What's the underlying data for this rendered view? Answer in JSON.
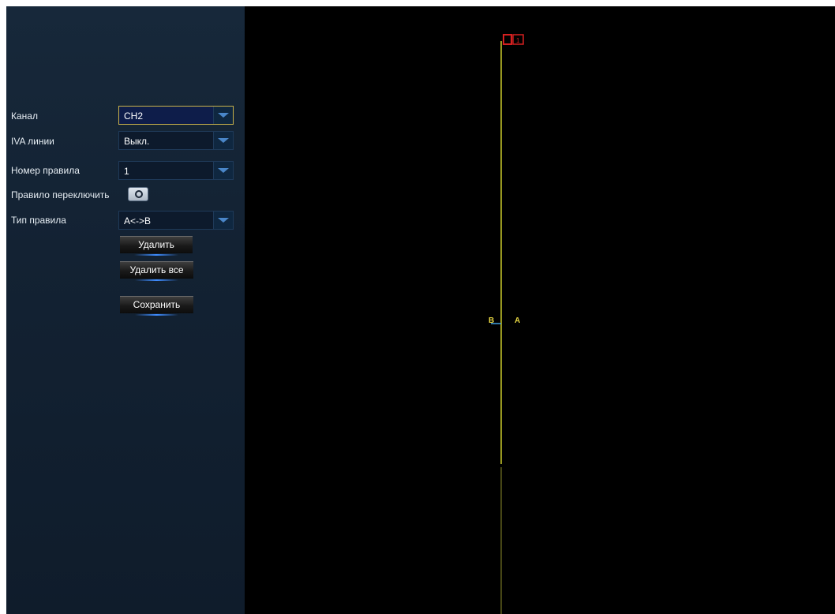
{
  "panel": {
    "channel": {
      "label": "Канал",
      "value": "CH2"
    },
    "iva_lines": {
      "label": "IVA линии",
      "value": "Выкл."
    },
    "rule_number": {
      "label": "Номер правила",
      "value": "1"
    },
    "rule_switch": {
      "label": "Правило переключить",
      "enabled": false
    },
    "rule_type": {
      "label": "Тип правила",
      "value": "A<->B"
    },
    "buttons": {
      "delete": "Удалить",
      "delete_all": "Удалить все",
      "save": "Сохранить"
    }
  },
  "video": {
    "line_id": "1",
    "point_a_label": "A",
    "point_b_label": "B",
    "colors": {
      "line": "#c8c82a",
      "handle": "#d42020",
      "label": "#e0d040",
      "direction": "#40a0e0"
    }
  }
}
